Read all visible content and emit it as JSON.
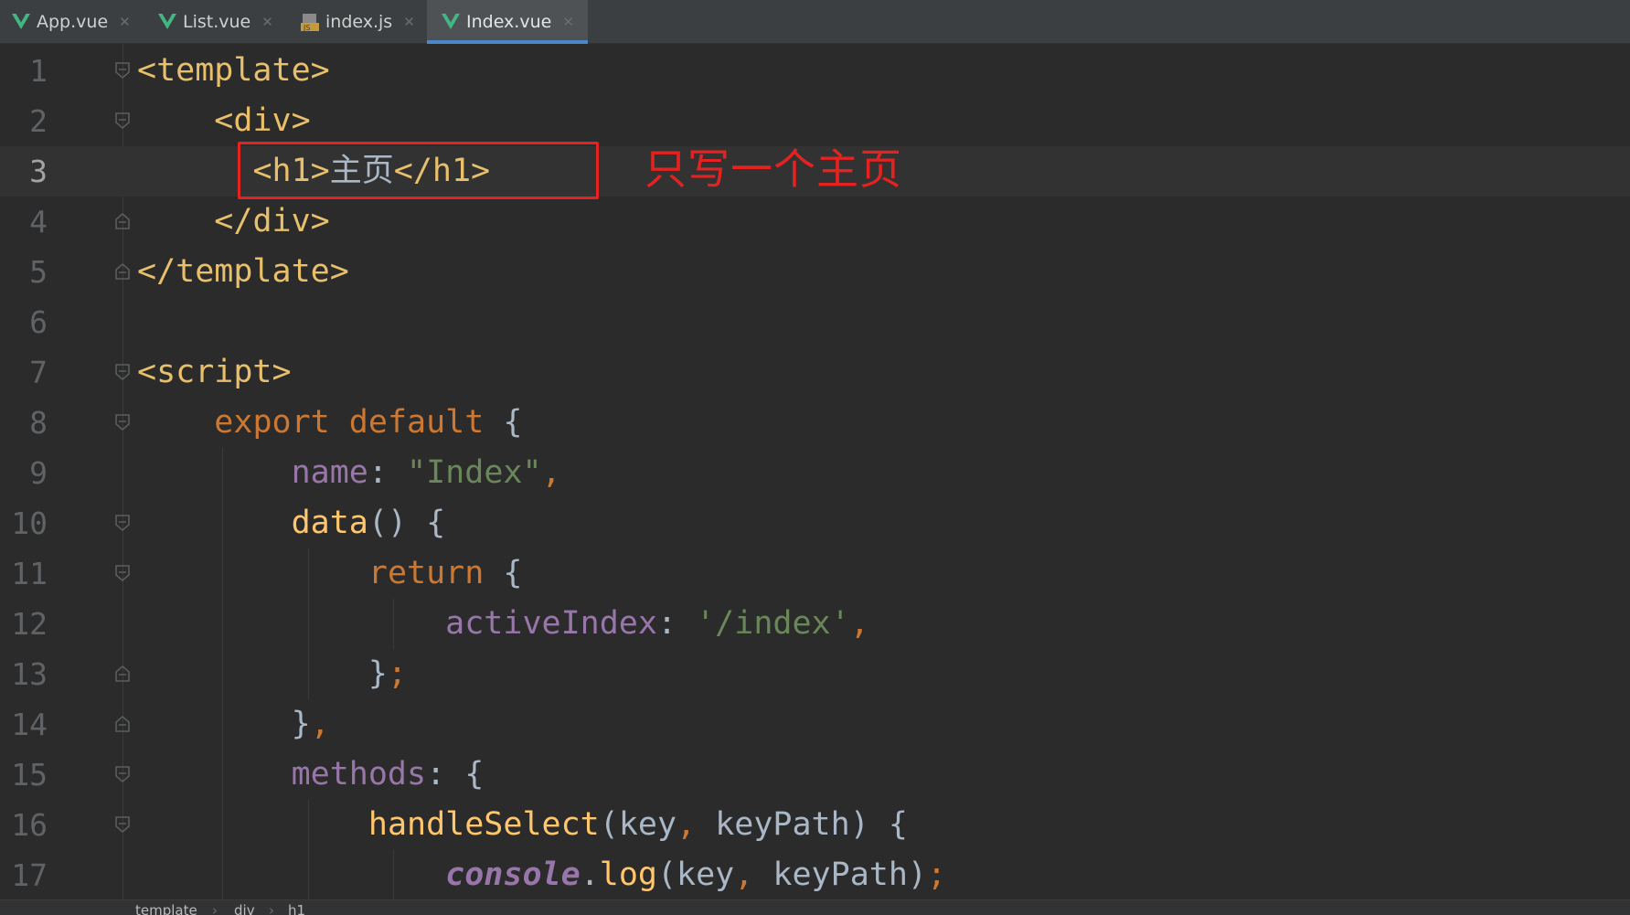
{
  "tabs": [
    {
      "label": "App.vue",
      "icon": "vue-icon",
      "active": false
    },
    {
      "label": "List.vue",
      "icon": "vue-icon",
      "active": false
    },
    {
      "label": "index.js",
      "icon": "js-file-icon",
      "active": false
    },
    {
      "label": "Index.vue",
      "icon": "vue-icon",
      "active": true
    }
  ],
  "colors": {
    "vue_green": "#41b883",
    "annotation_red": "#e5221f",
    "active_tab_underline": "#4a88c7"
  },
  "editor": {
    "current_line": 3,
    "line_numbers": [
      "1",
      "2",
      "3",
      "4",
      "5",
      "6",
      "7",
      "8",
      "9",
      "10",
      "11",
      "12",
      "13",
      "14",
      "15",
      "16",
      "17"
    ],
    "lines": [
      {
        "parts": [
          [
            "tag",
            "<template>"
          ]
        ]
      },
      {
        "parts": [
          [
            "plain",
            "    "
          ],
          [
            "tag",
            "<div>"
          ]
        ]
      },
      {
        "parts": [
          [
            "plain",
            "      "
          ],
          [
            "tag",
            "<h1>"
          ],
          [
            "plain",
            "主页"
          ],
          [
            "tag",
            "</h1>"
          ]
        ]
      },
      {
        "parts": [
          [
            "plain",
            "    "
          ],
          [
            "tag",
            "</div>"
          ]
        ]
      },
      {
        "parts": [
          [
            "tag",
            "</template>"
          ]
        ]
      },
      {
        "parts": []
      },
      {
        "parts": [
          [
            "tag",
            "<script>"
          ]
        ]
      },
      {
        "parts": [
          [
            "plain",
            "    "
          ],
          [
            "kw",
            "export default"
          ],
          [
            "plain",
            " {"
          ]
        ]
      },
      {
        "parts": [
          [
            "plain",
            "        "
          ],
          [
            "prop",
            "name"
          ],
          [
            "plain",
            ": "
          ],
          [
            "str",
            "\"Index\""
          ],
          [
            "kw",
            ","
          ]
        ]
      },
      {
        "parts": [
          [
            "plain",
            "        "
          ],
          [
            "fn",
            "data"
          ],
          [
            "plain",
            "() {"
          ]
        ]
      },
      {
        "parts": [
          [
            "plain",
            "            "
          ],
          [
            "kw",
            "return"
          ],
          [
            "plain",
            " {"
          ]
        ]
      },
      {
        "parts": [
          [
            "plain",
            "                "
          ],
          [
            "prop",
            "activeIndex"
          ],
          [
            "plain",
            ": "
          ],
          [
            "str",
            "'/index'"
          ],
          [
            "kw",
            ","
          ]
        ]
      },
      {
        "parts": [
          [
            "plain",
            "            }"
          ],
          [
            "kw",
            ";"
          ]
        ]
      },
      {
        "parts": [
          [
            "plain",
            "        }"
          ],
          [
            "kw",
            ","
          ]
        ]
      },
      {
        "parts": [
          [
            "plain",
            "        "
          ],
          [
            "prop",
            "methods"
          ],
          [
            "plain",
            ": {"
          ]
        ]
      },
      {
        "parts": [
          [
            "plain",
            "            "
          ],
          [
            "fn",
            "handleSelect"
          ],
          [
            "plain",
            "(key"
          ],
          [
            "kw",
            ","
          ],
          [
            "plain",
            " keyPath) {"
          ]
        ]
      },
      {
        "parts": [
          [
            "plain",
            "                "
          ],
          [
            "glob",
            "console"
          ],
          [
            "plain",
            "."
          ],
          [
            "fn",
            "log"
          ],
          [
            "plain",
            "(key"
          ],
          [
            "kw",
            ","
          ],
          [
            "plain",
            " keyPath)"
          ],
          [
            "kw",
            ";"
          ]
        ]
      }
    ]
  },
  "annotation": {
    "text": "只写一个主页"
  },
  "breadcrumb": [
    "template",
    "div",
    "h1"
  ]
}
